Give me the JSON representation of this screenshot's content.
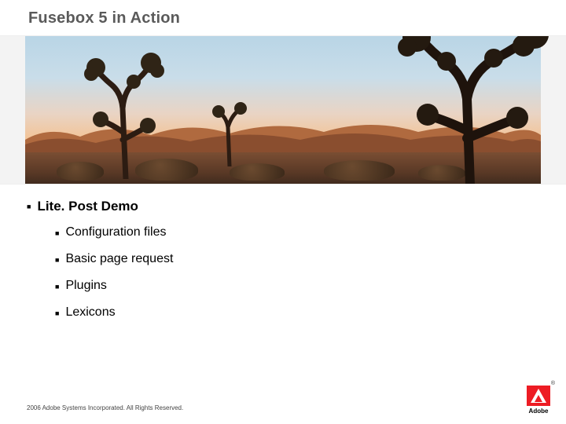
{
  "title": "Fusebox 5 in Action",
  "list": {
    "heading": "Lite. Post Demo",
    "items": [
      "Configuration files",
      "Basic page request",
      "Plugins",
      "Lexicons"
    ]
  },
  "footer": "2006 Adobe Systems Incorporated. All Rights Reserved.",
  "logo": {
    "brand": "Adobe",
    "registered": "®"
  }
}
